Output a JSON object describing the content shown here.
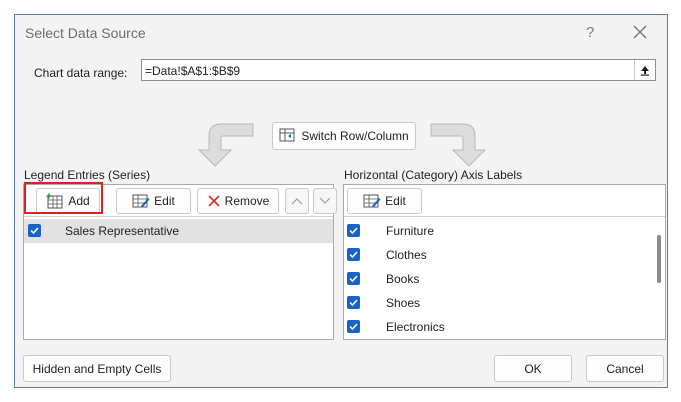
{
  "window": {
    "title": "Select Data Source",
    "help": "?"
  },
  "range": {
    "label": "Chart data range:",
    "value": "=Data!$A$1:$B$9"
  },
  "switch_button": "Switch Row/Column",
  "legend": {
    "label": "Legend Entries (Series)",
    "add_label": "Add",
    "edit_label": "Edit",
    "remove_label": "Remove",
    "series": [
      "Sales Representative"
    ]
  },
  "axis": {
    "label": "Horizontal (Category) Axis Labels",
    "edit_label": "Edit",
    "items": [
      "Furniture",
      "Clothes",
      "Books",
      "Shoes",
      "Electronics"
    ]
  },
  "footer": {
    "hidden_label": "Hidden and Empty Cells",
    "ok_label": "OK",
    "cancel_label": "Cancel"
  },
  "colors": {
    "checkbox": "#1a63c6",
    "highlight": "#e02020",
    "border": "#5b7fb0"
  }
}
